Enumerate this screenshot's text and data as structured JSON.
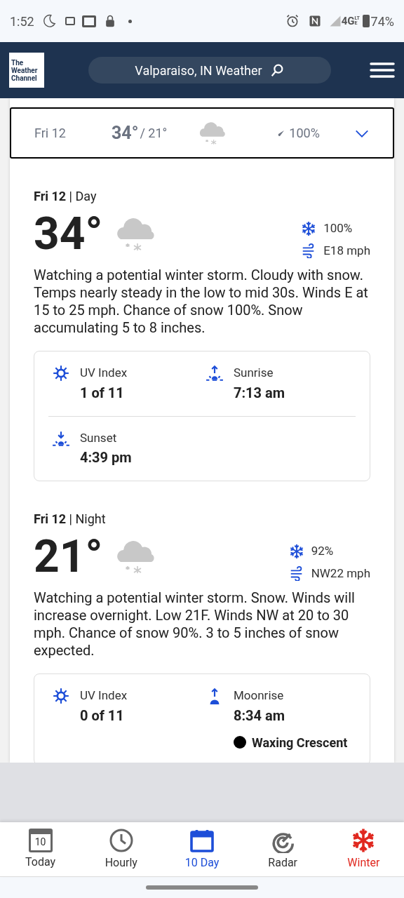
{
  "status_bar": {
    "time": "1:52",
    "network": "4G",
    "network_sub": "LTE",
    "battery": "74%"
  },
  "header": {
    "logo": [
      "The",
      "Weather",
      "Channel"
    ],
    "search": "Valparaiso, IN Weather"
  },
  "summary_row": {
    "day": "Fri 12",
    "high": "34°",
    "low": "/ 21°",
    "precip": "100%",
    "expanded": true
  },
  "periods": [
    {
      "title": "Fri 12",
      "part": "| Day",
      "temp": "34°",
      "precip": "100%",
      "wind": "E18 mph",
      "text": "Watching a potential winter storm. Cloudy with snow. Temps nearly steady in the low to mid 30s. Winds E at 15 to 25 mph. Chance of snow 100%. Snow accumulating 5 to 8 inches.",
      "details": [
        {
          "kind": "uv",
          "label": "UV Index",
          "value": "1 of 11"
        },
        {
          "kind": "sunrise",
          "label": "Sunrise",
          "value": "7:13 am"
        },
        {
          "kind": "sunset",
          "label": "Sunset",
          "value": "4:39 pm"
        }
      ]
    },
    {
      "title": "Fri 12",
      "part": "| Night",
      "temp": "21°",
      "precip": "92%",
      "wind": "NW22 mph",
      "text": "Watching a potential winter storm. Snow. Winds will increase overnight. Low 21F. Winds NW at 20 to 30 mph. Chance of snow 90%. 3 to 5 inches of snow expected.",
      "details": [
        {
          "kind": "uv",
          "label": "UV Index",
          "value": "0 of 11"
        },
        {
          "kind": "moonrise",
          "label": "Moonrise",
          "value": "8:34 am",
          "phase": "Waxing Crescent"
        }
      ]
    }
  ],
  "nav": [
    {
      "kind": "today",
      "label": "Today",
      "icon_text": "10",
      "selected": false,
      "alert": false
    },
    {
      "kind": "hourly",
      "label": "Hourly",
      "selected": false,
      "alert": false
    },
    {
      "kind": "tenday",
      "label": "10 Day",
      "selected": true,
      "alert": false
    },
    {
      "kind": "radar",
      "label": "Radar",
      "selected": false,
      "alert": false
    },
    {
      "kind": "winter",
      "label": "Winter",
      "selected": false,
      "alert": true
    }
  ]
}
